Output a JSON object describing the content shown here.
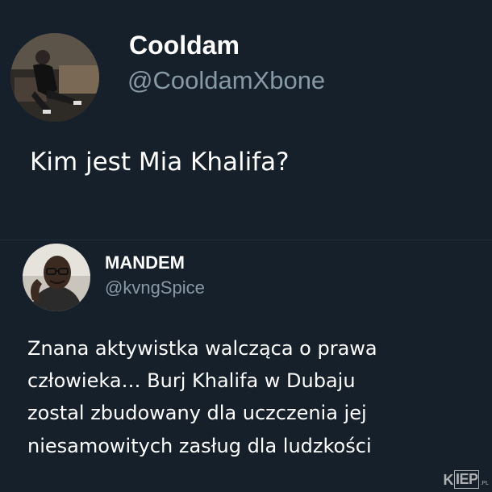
{
  "tweet_top": {
    "display_name": "Cooldam",
    "handle": "@CooldamXbone",
    "text": "Kim jest Mia Khalifa?",
    "avatar_icon": "user-photo-avatar"
  },
  "tweet_reply": {
    "display_name": "MANDEM",
    "handle": "@kvngSpice",
    "text_lines": [
      "Znana aktywistka walcząca o prawa",
      "człowieka… Burj Khalifa w Dubaju",
      "zostal zbudowany dla uczczenia jej",
      "niesamowitych zasług dla ludzkości"
    ],
    "avatar_icon": "user-photo-avatar"
  },
  "watermark": {
    "brand_a": "K",
    "brand_b": "IEP",
    "brand_c": ".PL"
  },
  "colors": {
    "background": "#15202b",
    "text_primary": "#ffffff",
    "text_secondary": "#8899a6"
  }
}
